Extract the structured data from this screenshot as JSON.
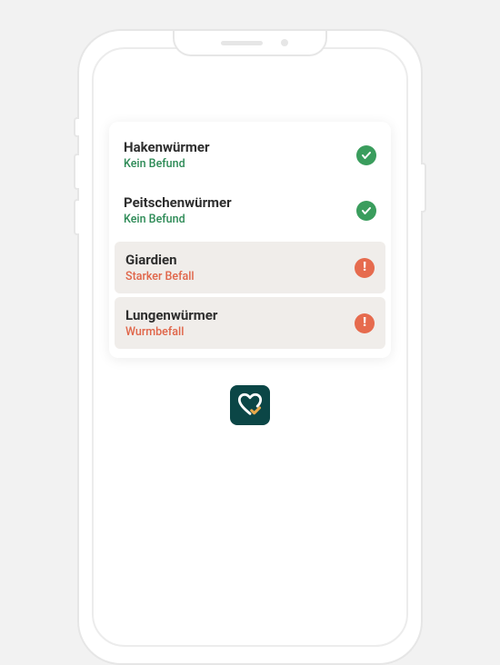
{
  "results": [
    {
      "title": "Hakenwürmer",
      "subtitle": "Kein Befund",
      "status": "ok"
    },
    {
      "title": "Peitschenwürmer",
      "subtitle": "Kein Befund",
      "status": "ok"
    },
    {
      "title": "Giardien",
      "subtitle": "Starker Befall",
      "status": "alert"
    },
    {
      "title": "Lungenwürmer",
      "subtitle": "Wurmbefall",
      "status": "alert"
    }
  ],
  "colors": {
    "ok": "#3a9d5d",
    "alert": "#e66b4e",
    "brand": "#0b4646"
  },
  "icons": {
    "ok": "checkmark-icon",
    "alert": "exclamation-icon",
    "app": "heart-check-icon"
  }
}
